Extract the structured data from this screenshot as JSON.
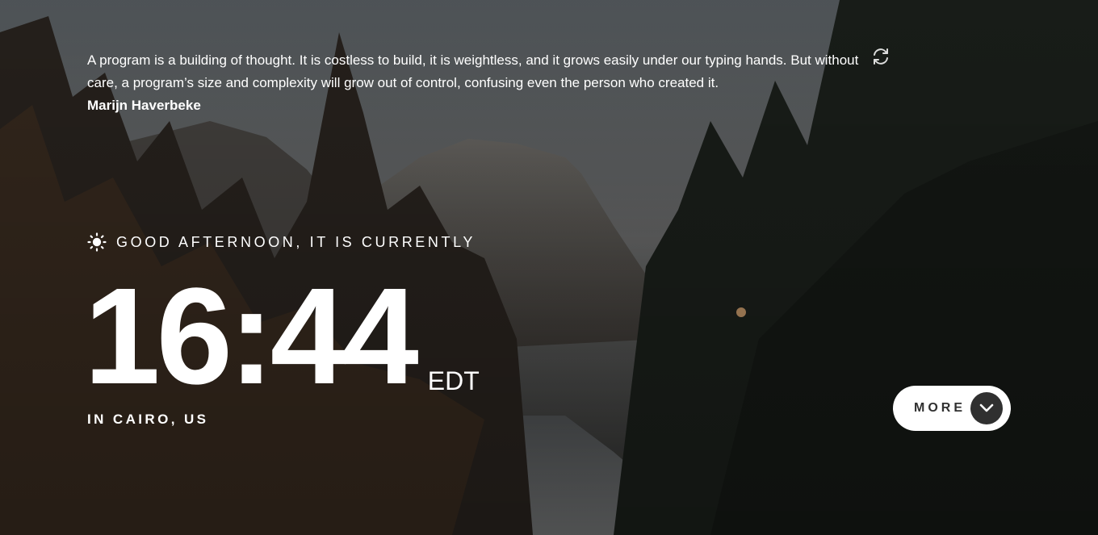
{
  "quote": {
    "text": "A program is a building of thought. It is costless to build, it is weightless, and it grows easily under our typing hands. But without care, a program’s size and complexity will grow out of control, confusing even the person who created it.",
    "author": "Marijn Haverbeke",
    "refresh_icon": "refresh-icon"
  },
  "greeting": {
    "icon": "sun-icon",
    "text": "Good afternoon, it is currently"
  },
  "clock": {
    "time": "16:44",
    "timezone": "EDT"
  },
  "location": {
    "text": "In Cairo, US"
  },
  "more_button": {
    "label": "More",
    "icon": "chevron-down-icon"
  },
  "colors": {
    "text": "#ffffff",
    "button_bg": "#ffffff",
    "button_text": "#303030",
    "button_icon_bg": "#303030"
  }
}
